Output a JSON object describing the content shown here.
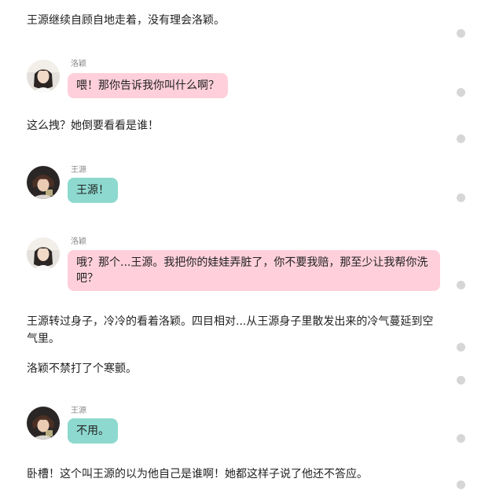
{
  "colors": {
    "pink_bubble": "#ffd0dc",
    "teal_bubble": "#8dd9cf",
    "dot": "#d6d6d6",
    "speaker_text": "#888888"
  },
  "story": [
    {
      "kind": "narration",
      "text": "王源继续自顾自地走着，没有理会洛颖。"
    },
    {
      "kind": "message",
      "speaker": "洛颖",
      "avatar": "girl-avatar",
      "text": "喂！那你告诉我你叫什么啊？"
    },
    {
      "kind": "narration",
      "text": "这么拽？她倒要看看是谁！"
    },
    {
      "kind": "message",
      "speaker": "王源",
      "avatar": "boy-avatar",
      "text": "王源！"
    },
    {
      "kind": "message",
      "speaker": "洛颖",
      "avatar": "girl-avatar",
      "text": "哦？那个...王源。我把你的娃娃弄脏了，你不要我赔，那至少让我帮你洗吧？"
    },
    {
      "kind": "narration",
      "text": "王源转过身子，冷冷的看着洛颖。四目相对...从王源身子里散发出来的冷气蔓延到空气里。"
    },
    {
      "kind": "narration",
      "text": "洛颖不禁打了个寒颤。"
    },
    {
      "kind": "message",
      "speaker": "王源",
      "avatar": "boy-avatar",
      "text": "不用。"
    },
    {
      "kind": "narration",
      "text": "卧槽！这个叫王源的以为他自己是谁啊！她都这样子说了他还不答应。"
    }
  ],
  "side_dots": 10
}
